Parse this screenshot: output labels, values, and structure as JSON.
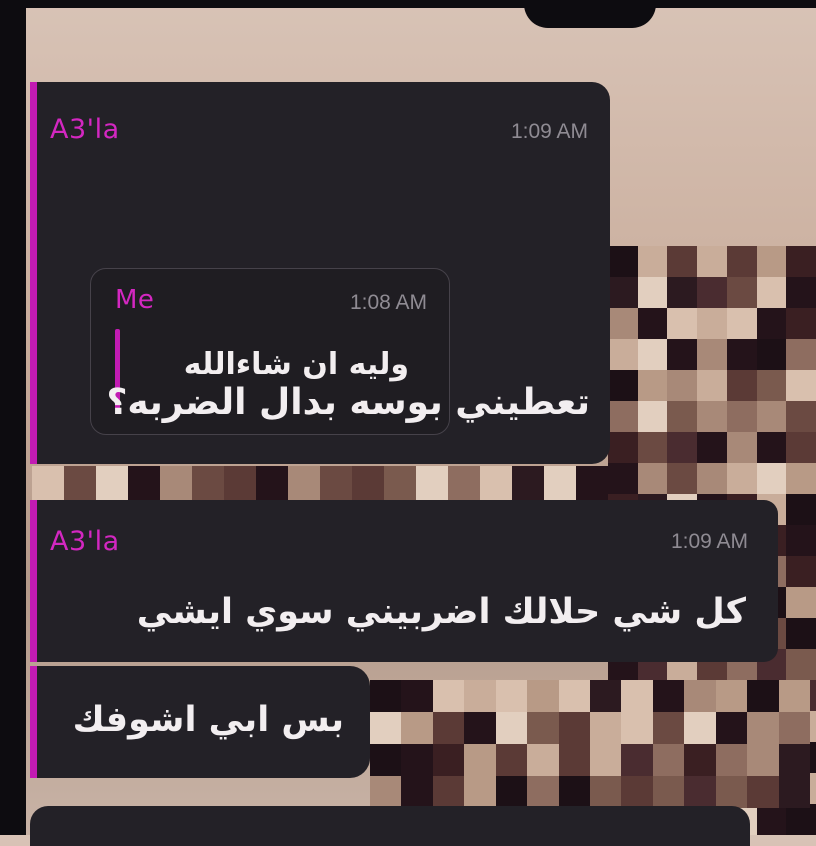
{
  "chat": {
    "messages": [
      {
        "sender": "A3'la",
        "time": "1:09 AM",
        "reply_to": {
          "sender": "Me",
          "time": "1:08 AM",
          "text": "وليه ان شاءالله"
        },
        "text": "تعطيني بوسه بدال الضربه؟"
      },
      {
        "sender": "A3'la",
        "time": "1:09 AM",
        "text": "كل شي حلالك اضربيني سوي ايشي"
      },
      {
        "text": "بس ابي اشوفك"
      }
    ]
  },
  "colors": {
    "accent": "#c21bb3",
    "sender_name": "#d327c1",
    "bubble_bg": "#232127",
    "timestamp": "#8f8b93"
  }
}
